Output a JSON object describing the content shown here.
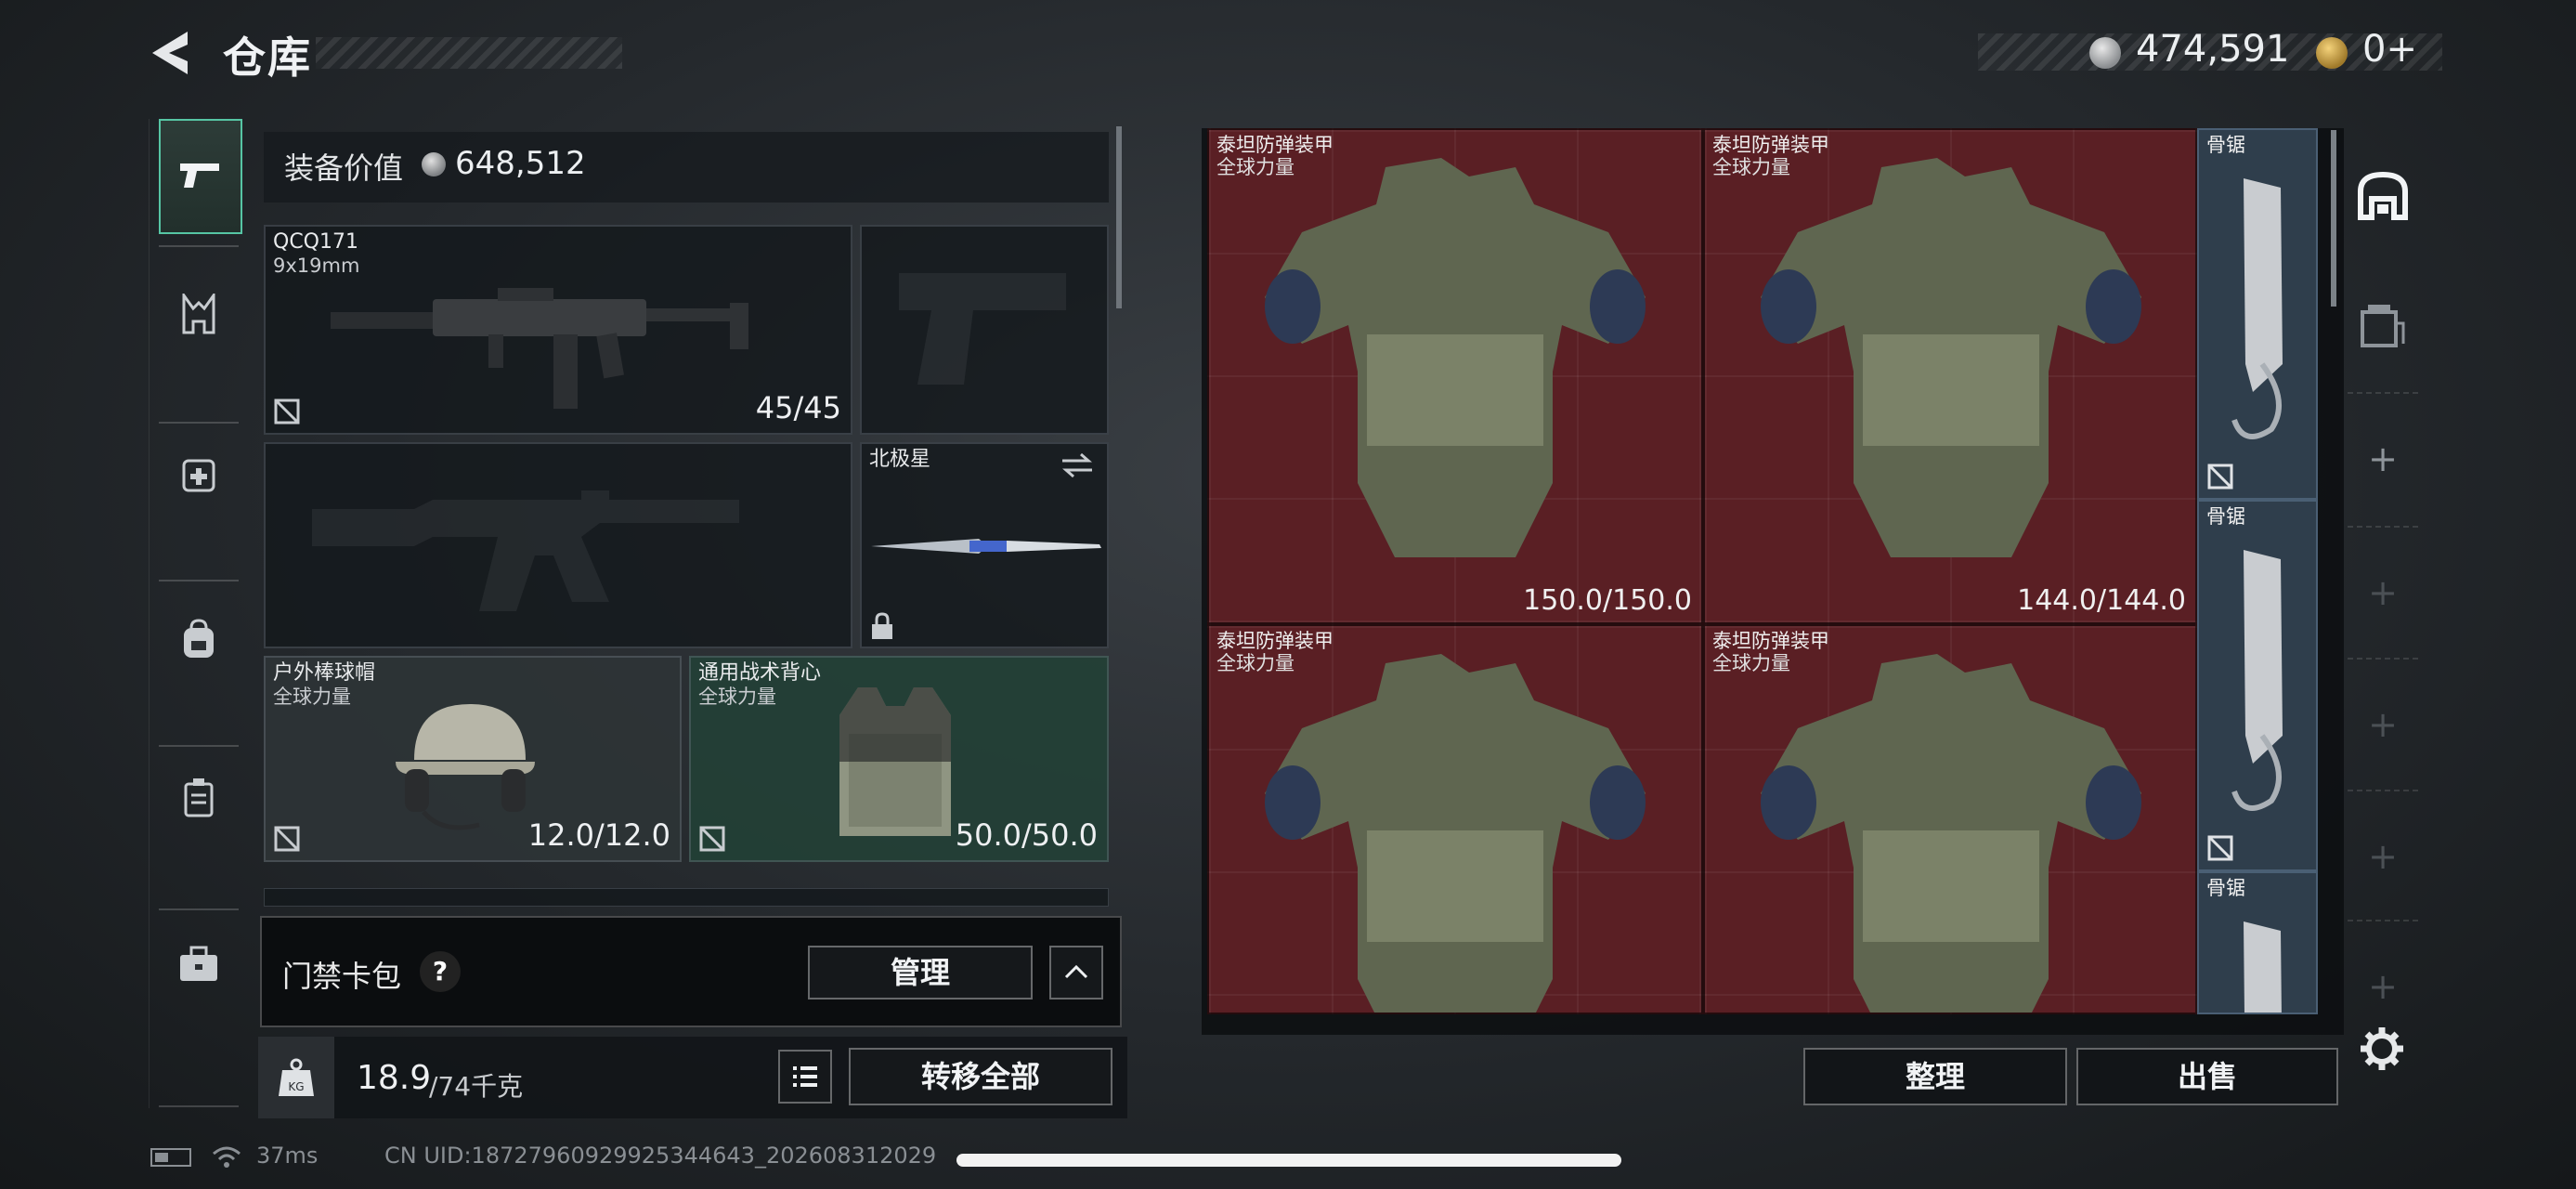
{
  "header": {
    "title": "仓库",
    "money": "474,591",
    "bonds": "0+",
    "coin_icon": "silver-coin-icon",
    "bond_icon": "gold-triangle-coin-icon"
  },
  "left_nav": {
    "items": [
      {
        "icon": "pistol-icon",
        "active": true
      },
      {
        "icon": "chest-rig-icon",
        "active": false
      },
      {
        "icon": "medkit-backpack-icon",
        "active": false
      },
      {
        "icon": "backpack-icon",
        "active": false
      },
      {
        "icon": "container-icon",
        "active": false
      },
      {
        "icon": "briefcase-icon",
        "active": false
      }
    ]
  },
  "loadout": {
    "equip_value_label": "装备价值",
    "equip_value": "648,512",
    "primary_weapon": {
      "name": "QCQ171",
      "ammo": "9x19mm",
      "durability": "45/45"
    },
    "melee": {
      "name": "北极星"
    },
    "helmet": {
      "name": "户外棒球帽",
      "brand": "全球力量",
      "durability": "12.0/12.0"
    },
    "armor": {
      "name": "通用战术背心",
      "brand": "全球力量",
      "durability": "50.0/50.0"
    },
    "keycard_label": "门禁卡包",
    "keycard_help": "?",
    "manage_label": "管理",
    "weight_value": "18.9",
    "weight_max": "/74千克",
    "transfer_label": "转移全部"
  },
  "inventory": {
    "items": [
      {
        "name": "泰坦防弹装甲",
        "brand": "全球力量",
        "durability": "150.0/150.0"
      },
      {
        "name": "泰坦防弹装甲",
        "brand": "全球力量",
        "durability": "144.0/144.0"
      },
      {
        "name": "泰坦防弹装甲",
        "brand": "全球力量",
        "durability": ""
      },
      {
        "name": "泰坦防弹装甲",
        "brand": "全球力量",
        "durability": ""
      }
    ],
    "side_items": [
      {
        "name": "骨锯"
      },
      {
        "name": "骨锯"
      },
      {
        "name": "骨锯"
      }
    ],
    "sort_label": "整理",
    "sell_label": "出售"
  },
  "right_rail": {
    "plus": "+"
  },
  "status": {
    "ping": "37ms",
    "uid": "CN UID:18727960929925344643_202608312029"
  },
  "colors": {
    "accent": "#56c5a4",
    "inventory_red": "#5a1f24",
    "item_blue": "#2f3e4c"
  }
}
